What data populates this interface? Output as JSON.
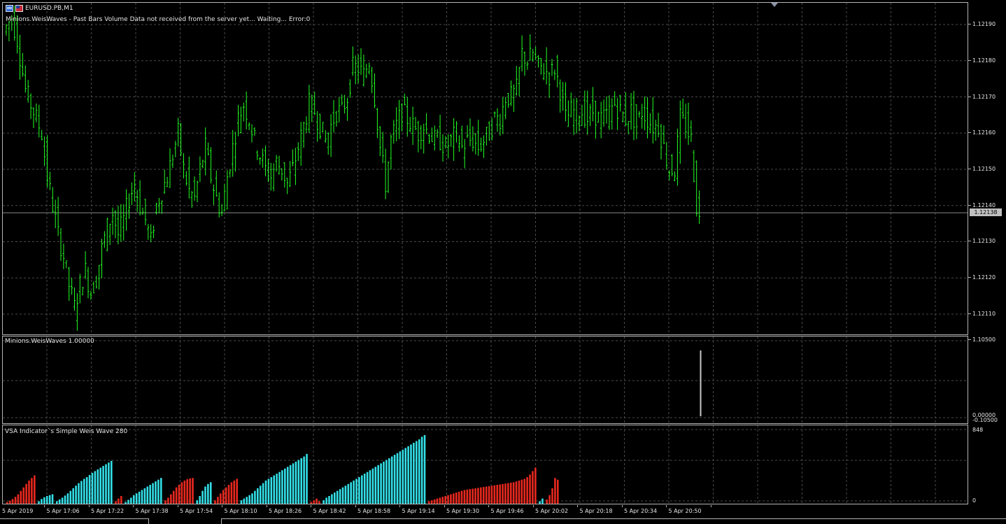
{
  "chart": {
    "title": "EURUSD.PB,M1",
    "status_line": "Minions.WeisWaves - Past Bars Volume Data not received from the server yet... Waiting...   Error:0",
    "current_price": "1.12138",
    "colors": {
      "background": "#000000",
      "grid": "#4a4a4a",
      "candle": "#22ff22",
      "up_wave": "#33e0e8",
      "down_wave": "#e8281e",
      "indicator_line": "#c8c8c8"
    }
  },
  "price_axis": {
    "labels": [
      "1.12190",
      "1.12180",
      "1.12170",
      "1.12160",
      "1.12150",
      "1.12140",
      "1.12130",
      "1.12120",
      "1.12110"
    ]
  },
  "weis_pane": {
    "label": "Minions.WeisWaves 1.00000",
    "axis_top": "1.10500",
    "axis_bottom": "0.00000",
    "axis_bottom2": "-0.10500"
  },
  "vsa_pane": {
    "label": "VSA Indicator`s Simple Weis Wave  280",
    "axis_top": "848",
    "axis_bottom": "0"
  },
  "time_axis": {
    "labels": [
      "5 Apr 2019",
      "5 Apr 17:06",
      "5 Apr 17:22",
      "5 Apr 17:38",
      "5 Apr 17:54",
      "5 Apr 18:10",
      "5 Apr 18:26",
      "5 Apr 18:42",
      "5 Apr 18:58",
      "5 Apr 19:14",
      "5 Apr 19:30",
      "5 Apr 19:46",
      "5 Apr 20:02",
      "5 Apr 20:18",
      "5 Apr 20:34",
      "5 Apr 20:50"
    ]
  },
  "chart_data": {
    "type": "candlestick",
    "symbol": "EURUSD.PB",
    "timeframe": "M1",
    "ylim": [
      1.12104,
      1.12196
    ],
    "close_path": [
      [
        0,
        1.12188
      ],
      [
        3,
        1.12192
      ],
      [
        5,
        1.12186
      ],
      [
        8,
        1.12172
      ],
      [
        11,
        1.12166
      ],
      [
        14,
        1.1216
      ],
      [
        16,
        1.12148
      ],
      [
        18,
        1.1214
      ],
      [
        20,
        1.12132
      ],
      [
        22,
        1.12126
      ],
      [
        24,
        1.12118
      ],
      [
        26,
        1.12112
      ],
      [
        28,
        1.12118
      ],
      [
        30,
        1.12122
      ],
      [
        32,
        1.12116
      ],
      [
        34,
        1.1212
      ],
      [
        36,
        1.12128
      ],
      [
        38,
        1.12134
      ],
      [
        40,
        1.12138
      ],
      [
        42,
        1.12132
      ],
      [
        44,
        1.12136
      ],
      [
        46,
        1.12142
      ],
      [
        48,
        1.12146
      ],
      [
        50,
        1.1214
      ],
      [
        52,
        1.12136
      ],
      [
        54,
        1.1213
      ],
      [
        56,
        1.1214
      ],
      [
        58,
        1.12144
      ],
      [
        60,
        1.12148
      ],
      [
        62,
        1.12154
      ],
      [
        64,
        1.1216
      ],
      [
        66,
        1.1215
      ],
      [
        68,
        1.12144
      ],
      [
        70,
        1.12142
      ],
      [
        72,
        1.1215
      ],
      [
        74,
        1.12156
      ],
      [
        76,
        1.12148
      ],
      [
        78,
        1.12142
      ],
      [
        80,
        1.12138
      ],
      [
        82,
        1.12148
      ],
      [
        84,
        1.12156
      ],
      [
        86,
        1.12164
      ],
      [
        88,
        1.12168
      ],
      [
        90,
        1.12164
      ],
      [
        92,
        1.12158
      ],
      [
        94,
        1.12154
      ],
      [
        96,
        1.1215
      ],
      [
        98,
        1.12148
      ],
      [
        100,
        1.12152
      ],
      [
        102,
        1.1215
      ],
      [
        104,
        1.12146
      ],
      [
        106,
        1.1215
      ],
      [
        108,
        1.12156
      ],
      [
        110,
        1.12162
      ],
      [
        112,
        1.12168
      ],
      [
        114,
        1.12166
      ],
      [
        116,
        1.12162
      ],
      [
        118,
        1.12158
      ],
      [
        120,
        1.12162
      ],
      [
        122,
        1.12166
      ],
      [
        124,
        1.12166
      ],
      [
        126,
        1.1217
      ],
      [
        128,
        1.12178
      ],
      [
        130,
        1.12178
      ],
      [
        132,
        1.12176
      ],
      [
        134,
        1.1218
      ],
      [
        136,
        1.1217
      ],
      [
        138,
        1.12156
      ],
      [
        140,
        1.12146
      ],
      [
        142,
        1.12158
      ],
      [
        144,
        1.12162
      ],
      [
        146,
        1.12166
      ],
      [
        148,
        1.12164
      ],
      [
        150,
        1.12162
      ],
      [
        152,
        1.1216
      ],
      [
        154,
        1.12162
      ],
      [
        156,
        1.1216
      ],
      [
        158,
        1.12158
      ],
      [
        160,
        1.12158
      ],
      [
        162,
        1.12156
      ],
      [
        164,
        1.12158
      ],
      [
        166,
        1.1216
      ],
      [
        168,
        1.12156
      ],
      [
        170,
        1.12158
      ],
      [
        172,
        1.12158
      ],
      [
        174,
        1.12156
      ],
      [
        176,
        1.12158
      ],
      [
        178,
        1.1216
      ],
      [
        180,
        1.12164
      ],
      [
        182,
        1.12164
      ],
      [
        184,
        1.1217
      ],
      [
        186,
        1.1217
      ],
      [
        188,
        1.12172
      ],
      [
        190,
        1.12182
      ],
      [
        192,
        1.1218
      ],
      [
        194,
        1.12182
      ],
      [
        196,
        1.12178
      ],
      [
        198,
        1.12178
      ],
      [
        200,
        1.12176
      ],
      [
        202,
        1.12178
      ],
      [
        204,
        1.12172
      ],
      [
        206,
        1.12164
      ],
      [
        208,
        1.12166
      ],
      [
        210,
        1.12166
      ],
      [
        212,
        1.12166
      ],
      [
        214,
        1.12164
      ],
      [
        216,
        1.12166
      ],
      [
        218,
        1.12164
      ],
      [
        220,
        1.12164
      ],
      [
        222,
        1.12166
      ],
      [
        224,
        1.12168
      ],
      [
        226,
        1.12166
      ],
      [
        228,
        1.12164
      ],
      [
        230,
        1.12166
      ],
      [
        232,
        1.12162
      ],
      [
        234,
        1.12166
      ],
      [
        236,
        1.12164
      ],
      [
        238,
        1.12162
      ],
      [
        240,
        1.12162
      ],
      [
        242,
        1.12156
      ],
      [
        244,
        1.1215
      ],
      [
        246,
        1.1215
      ],
      [
        248,
        1.12164
      ],
      [
        250,
        1.12162
      ],
      [
        252,
        1.12158
      ],
      [
        254,
        1.1214
      ],
      [
        255,
        1.12136
      ]
    ],
    "weis_wave_pane": {
      "range": [
        0.0,
        1.105
      ],
      "last_bar_value": 1.0
    },
    "vsa_weis_wave": {
      "ylim": [
        0,
        848
      ],
      "waves": [
        {
          "dir": "down",
          "values": [
            20,
            35,
            55,
            80,
            110,
            150,
            190,
            230,
            270,
            300,
            330
          ]
        },
        {
          "dir": "up",
          "values": [
            30,
            55,
            75,
            90,
            100,
            110
          ]
        },
        {
          "dir": "up",
          "values": [
            30,
            50,
            70,
            95,
            120,
            150,
            180,
            210,
            240,
            265,
            290,
            310,
            335,
            360,
            380,
            400,
            420,
            440,
            460,
            480,
            500
          ]
        },
        {
          "dir": "down",
          "values": [
            30,
            60,
            90
          ]
        },
        {
          "dir": "up",
          "values": [
            20,
            45,
            70,
            100,
            120,
            140,
            160,
            180,
            200,
            220,
            240,
            260,
            280,
            300
          ]
        },
        {
          "dir": "down",
          "values": [
            40,
            70,
            110,
            150,
            190,
            220,
            250,
            270,
            285,
            295,
            300
          ]
        },
        {
          "dir": "up",
          "values": [
            40,
            90,
            150,
            200,
            230,
            250
          ]
        },
        {
          "dir": "down",
          "values": [
            40,
            80,
            120,
            160,
            190,
            220,
            250,
            270,
            290
          ]
        },
        {
          "dir": "up",
          "values": [
            40,
            60,
            80,
            100,
            120,
            150,
            180,
            210,
            240,
            270,
            290,
            310,
            330,
            350,
            370,
            390,
            410,
            430,
            450,
            470,
            490,
            510,
            530,
            550,
            580
          ]
        },
        {
          "dir": "down",
          "values": [
            20,
            40,
            60,
            30
          ]
        },
        {
          "dir": "up",
          "values": [
            40,
            70,
            90,
            110,
            130,
            150,
            170,
            190,
            210,
            230,
            250,
            270,
            290,
            310,
            330,
            350,
            370,
            390,
            410,
            430,
            450,
            470,
            490,
            510,
            530,
            550,
            570,
            590,
            610,
            630,
            650,
            670,
            690,
            710,
            730,
            750,
            780,
            800
          ]
        },
        {
          "dir": "down",
          "values": [
            30,
            40,
            50,
            60,
            70,
            80,
            90,
            100,
            110,
            120,
            130,
            140,
            150,
            160,
            165,
            170,
            175,
            180,
            185,
            190,
            195,
            200,
            205,
            210,
            215,
            220,
            225,
            230,
            235,
            240,
            245,
            250,
            260,
            270,
            280,
            290,
            310,
            340,
            380,
            420
          ]
        },
        {
          "dir": "up",
          "values": [
            30,
            60
          ]
        },
        {
          "dir": "down",
          "values": [
            50,
            100,
            180,
            300,
            280
          ]
        }
      ]
    }
  }
}
